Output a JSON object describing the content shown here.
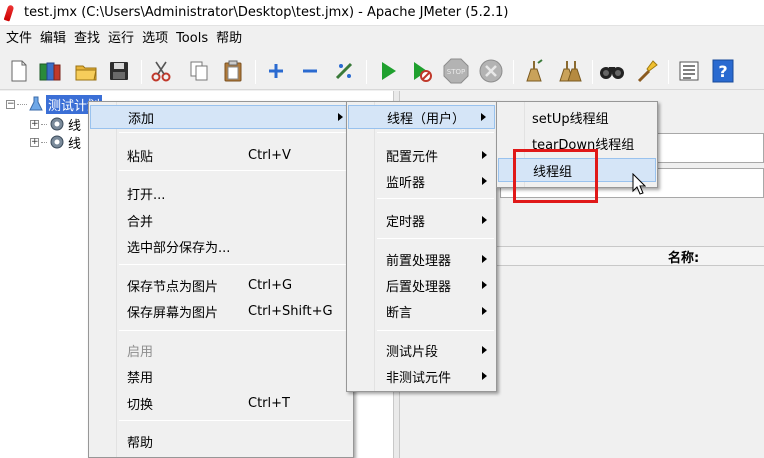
{
  "window": {
    "title": "test.jmx (C:\\Users\\Administrator\\Desktop\\test.jmx) - Apache JMeter (5.2.1)"
  },
  "menubar": [
    "文件",
    "编辑",
    "查找",
    "运行",
    "选项",
    "Tools",
    "帮助"
  ],
  "toolbar": {
    "icons": [
      "new-icon",
      "templates-icon",
      "open-icon",
      "save-icon",
      "cut-icon",
      "copy-icon",
      "paste-icon",
      "expand-icon",
      "collapse-icon",
      "toggle-icon",
      "start-icon",
      "start-no-pause-icon",
      "stop-icon",
      "shutdown-icon",
      "clear-icon",
      "clear-all-icon",
      "search-icon",
      "reset-search-icon",
      "function-helper-icon",
      "help-icon"
    ]
  },
  "tree": {
    "root_label": "测试计划",
    "child_labels": [
      "线",
      "线"
    ]
  },
  "context_menu": {
    "items": [
      {
        "label": "添加",
        "shortcut": "",
        "submenu": true
      },
      {
        "label": "粘贴",
        "shortcut": "Ctrl+V"
      },
      {
        "label": "打开...",
        "shortcut": ""
      },
      {
        "label": "合并",
        "shortcut": ""
      },
      {
        "label": "选中部分保存为...",
        "shortcut": ""
      },
      {
        "label": "保存节点为图片",
        "shortcut": "Ctrl+G"
      },
      {
        "label": "保存屏幕为图片",
        "shortcut": "Ctrl+Shift+G"
      },
      {
        "label": "启用",
        "shortcut": "",
        "disabled": true
      },
      {
        "label": "禁用",
        "shortcut": ""
      },
      {
        "label": "切换",
        "shortcut": "Ctrl+T"
      },
      {
        "label": "帮助",
        "shortcut": ""
      }
    ]
  },
  "add_submenu": {
    "items": [
      "线程（用户）",
      "配置元件",
      "监听器",
      "定时器",
      "前置处理器",
      "后置处理器",
      "断言",
      "测试片段",
      "非测试元件"
    ]
  },
  "thread_submenu": {
    "items": [
      "setUp线程组",
      "tearDown线程组",
      "线程组"
    ]
  },
  "right_pane": {
    "table_header_name": "名称:"
  },
  "colors": {
    "highlight": "#d5e5f7",
    "selection": "#3b6fd6",
    "annotation_box": "#e01818"
  }
}
